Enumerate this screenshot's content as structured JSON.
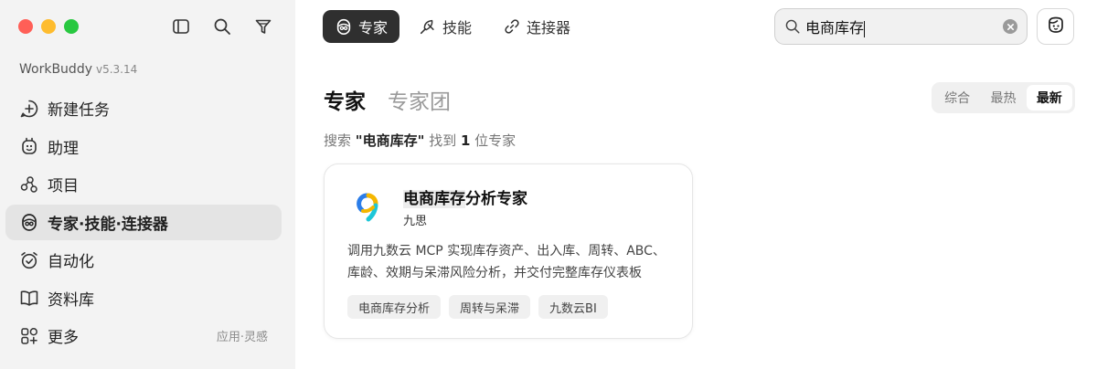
{
  "sidebar": {
    "app_name": "WorkBuddy",
    "version": "v5.3.14",
    "items": [
      {
        "label": "新建任务",
        "icon": "new-task-icon"
      },
      {
        "label": "助理",
        "icon": "assistant-icon"
      },
      {
        "label": "项目",
        "icon": "project-icon"
      },
      {
        "label": "专家·技能·连接器",
        "icon": "expert-icon",
        "active": true
      },
      {
        "label": "自动化",
        "icon": "alarm-icon"
      },
      {
        "label": "资料库",
        "icon": "book-icon"
      },
      {
        "label": "更多",
        "icon": "more-apps-icon",
        "hint": "应用·灵感"
      }
    ]
  },
  "tabs": [
    {
      "label": "专家",
      "icon": "expert-icon",
      "active": true
    },
    {
      "label": "技能",
      "icon": "skill-icon"
    },
    {
      "label": "连接器",
      "icon": "link-icon"
    }
  ],
  "search": {
    "value": "电商库存"
  },
  "heading": {
    "main": "专家",
    "sub": "专家团"
  },
  "sort": {
    "options": [
      "综合",
      "最热",
      "最新"
    ],
    "selected": "最新"
  },
  "result": {
    "prefix": "搜索 ",
    "query": "\"电商库存\"",
    "mid": " 找到 ",
    "count": "1",
    "suffix": " 位专家"
  },
  "card": {
    "title_highlight": "电商库存",
    "title_rest": "分析专家",
    "author": "九思",
    "description": "调用九数云 MCP 实现库存资产、出入库、周转、ABC、库龄、效期与呆滞风险分析，并交付完整库存仪表板",
    "tags": [
      "电商库存分析",
      "周转与呆滞",
      "九数云BI"
    ]
  },
  "colors": {
    "active_tab_bg": "#2f2f2f",
    "sidebar_bg": "#f3f3f3",
    "logo_blue": "#2b7de9",
    "logo_yellow": "#f5b700",
    "logo_cyan": "#1ec7d8"
  }
}
